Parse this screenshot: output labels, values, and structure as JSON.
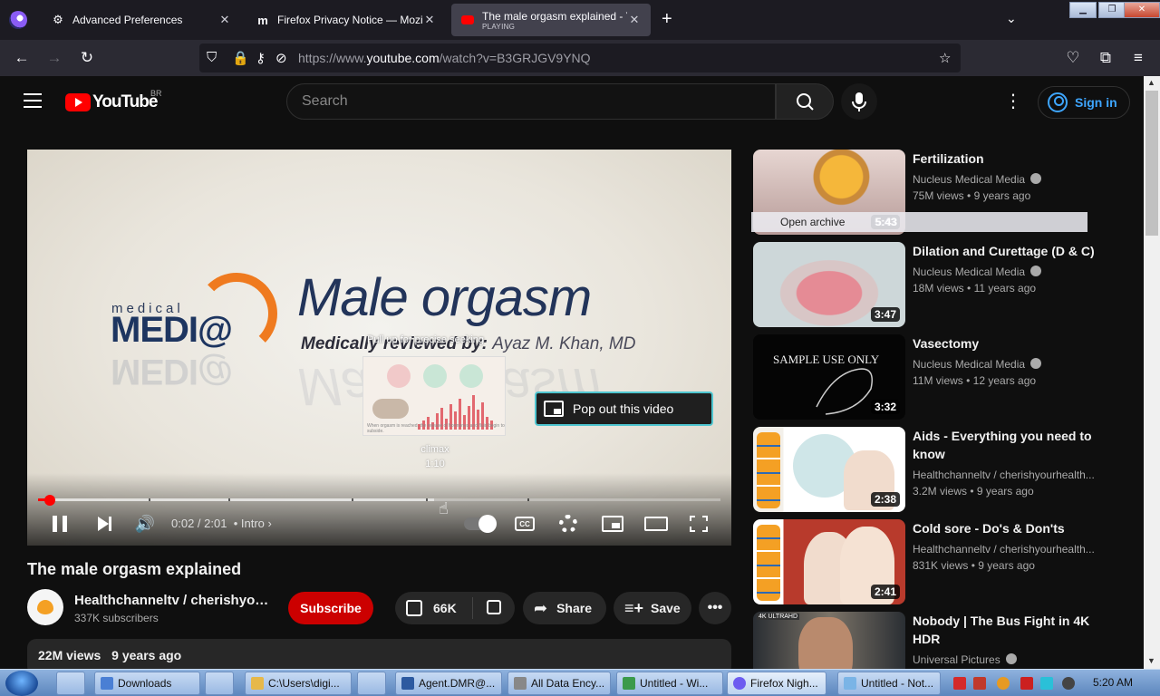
{
  "browser": {
    "tabs": [
      {
        "title": "Advanced Preferences",
        "icon": "gear-icon"
      },
      {
        "title": "Firefox Privacy Notice — Mozilla",
        "icon": "mozilla-m-icon"
      },
      {
        "title": "The male orgasm explained - YouTube",
        "subtitle": "PLAYING",
        "icon": "youtube-icon",
        "active": true
      }
    ],
    "url": {
      "prefix": "https://www.",
      "host": "youtube.com",
      "path": "/watch?v=B3GRJGV9YNQ"
    }
  },
  "youtube": {
    "logo_text": "YouTube",
    "region": "BR",
    "search_placeholder": "Search",
    "sign_in": "Sign in"
  },
  "player": {
    "slide": {
      "brand_small": "medical",
      "brand_big": "MEDI@",
      "title": "Male orgasm",
      "byline_prefix": "Medically reviewed by:",
      "byline_author": "Ayaz M. Khan, MD"
    },
    "seek_hint": "Pull up for precise seeking",
    "storyboard_caption": "When orgasm is reached, the release of hormones and fluid begin to subside.",
    "preview_chapter": "climax",
    "preview_time": "1:10",
    "popout_label": "Pop out this video",
    "current_time": "0:02",
    "duration": "2:01",
    "chapter": "Intro",
    "played_fraction": 0.017,
    "loaded_fraction": 0.58,
    "cc_label": "CC"
  },
  "video": {
    "title": "The male orgasm explained",
    "channel": "Healthchanneltv / cherishyourhealth",
    "subscribers": "337K subscribers",
    "subscribe_label": "Subscribe",
    "likes": "66K",
    "share_label": "Share",
    "save_label": "Save",
    "views": "22M views",
    "age": "9 years ago"
  },
  "recommendations": [
    {
      "title": "Fertilization",
      "title2": "",
      "channel": "Nucleus Medical Media",
      "verified": true,
      "views": "75M views",
      "age": "9 years ago",
      "duration": "5:43",
      "thumb": "egg"
    },
    {
      "title": "Dilation and Curettage (D & C)",
      "title2": "",
      "channel": "Nucleus Medical Media",
      "verified": true,
      "views": "18M views",
      "age": "11 years ago",
      "duration": "3:47",
      "thumb": "anatomy"
    },
    {
      "title": "Vasectomy",
      "title2": "",
      "channel": "Nucleus Medical Media",
      "verified": true,
      "views": "11M views",
      "age": "12 years ago",
      "duration": "3:32",
      "thumb": "sample",
      "thumb_text": "SAMPLE USE ONLY"
    },
    {
      "title": "Aids - Everything you need to",
      "title2": "know",
      "channel": "Healthchanneltv / cherishyourhealth...",
      "verified": false,
      "views": "3.2M views",
      "age": "9 years ago",
      "duration": "2:38",
      "thumb": "couple"
    },
    {
      "title": "Cold sore - Do's & Don'ts",
      "title2": "",
      "channel": "Healthchanneltv / cherishyourhealth...",
      "verified": false,
      "views": "831K views",
      "age": "9 years ago",
      "duration": "2:41",
      "thumb": "kiss"
    },
    {
      "title": "Nobody | The Bus Fight in 4K",
      "title2": "HDR",
      "channel": "Universal Pictures",
      "verified": true,
      "views": "",
      "age": "",
      "duration": "",
      "thumb": "movie",
      "thumb_badge": "4K ULTRAHD"
    }
  ],
  "overlay": {
    "open_archive": "Open archive"
  },
  "taskbar": {
    "items": [
      {
        "label": "Downloads"
      },
      {
        "label": "C:\\Users\\digi..."
      },
      {
        "label": "Agent.DMR@..."
      },
      {
        "label": "All Data Ency..."
      },
      {
        "label": "Untitled - Wi..."
      },
      {
        "label": "Firefox Nigh..."
      },
      {
        "label": "Untitled - Not..."
      }
    ],
    "clock": "5:20 AM"
  },
  "colors": {
    "yt_red": "#ff0000",
    "subscribe_red": "#cc0000",
    "link_blue": "#3ea6ff",
    "popout_border": "#4fc6d0"
  }
}
